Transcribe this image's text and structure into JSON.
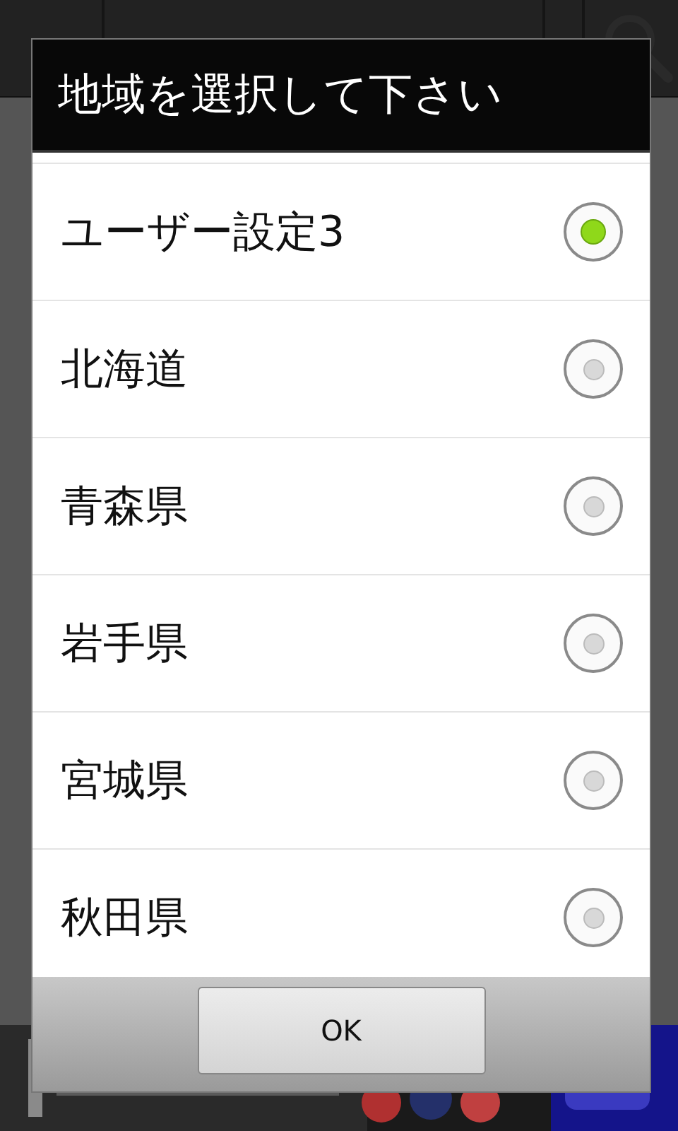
{
  "dialog": {
    "title": "地域を選択して下さい",
    "options": [
      {
        "label": "ユーザー設定3",
        "selected": true
      },
      {
        "label": "北海道",
        "selected": false
      },
      {
        "label": "青森県",
        "selected": false
      },
      {
        "label": "岩手県",
        "selected": false
      },
      {
        "label": "宮城県",
        "selected": false
      },
      {
        "label": "秋田県",
        "selected": false
      }
    ],
    "buttons": [
      "OK"
    ]
  }
}
